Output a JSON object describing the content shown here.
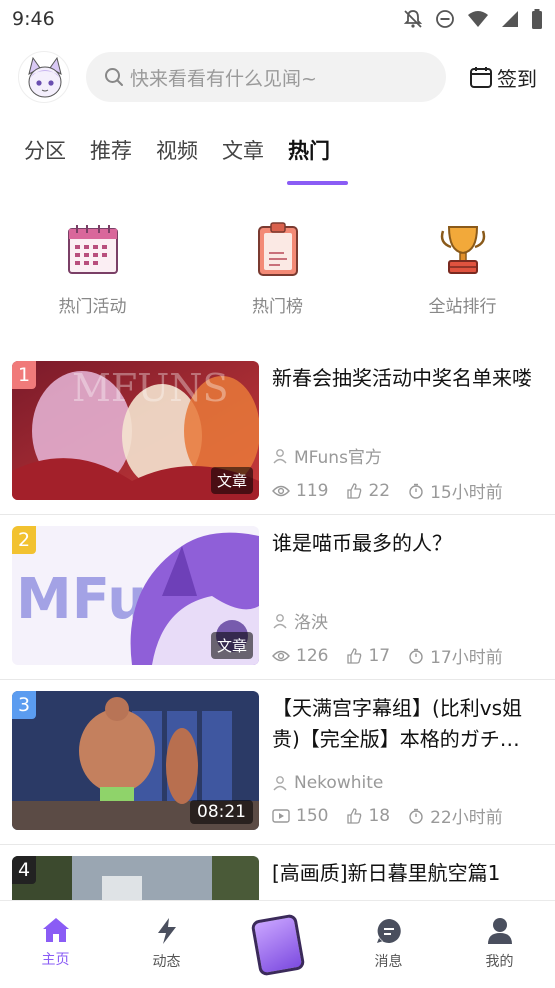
{
  "status_bar": {
    "time": "9:46"
  },
  "header": {
    "search_placeholder": "快来看看有什么见闻~",
    "checkin_label": "签到"
  },
  "tabs": [
    {
      "label": "分区"
    },
    {
      "label": "推荐"
    },
    {
      "label": "视频"
    },
    {
      "label": "文章"
    },
    {
      "label": "热门",
      "active": true
    }
  ],
  "quick_entries": [
    {
      "label": "热门活动",
      "icon": "calendar-icon"
    },
    {
      "label": "热门榜",
      "icon": "clipboard-icon"
    },
    {
      "label": "全站排行",
      "icon": "trophy-icon"
    }
  ],
  "feed": [
    {
      "rank": "1",
      "rank_color": "#f07a7a",
      "title": "新春会抽奖活动中奖名单来喽",
      "tag": "文章",
      "author": "MFuns官方",
      "views": "119",
      "likes": "22",
      "time": "15小时前"
    },
    {
      "rank": "2",
      "rank_color": "#f2c230",
      "title": "谁是喵币最多的人？",
      "tag": "文章",
      "author": "洛泱",
      "views": "126",
      "likes": "17",
      "time": "17小时前"
    },
    {
      "rank": "3",
      "rank_color": "#5b9cf0",
      "title": "【天满宫字幕组】(比利vs姐贵)【完全版】本格的ガチ…",
      "tag": "08:21",
      "author": "Nekowhite",
      "views": "150",
      "likes": "18",
      "time": "22小时前"
    },
    {
      "rank": "4",
      "rank_color": "#222222",
      "title": "[高画质]新日暮里航空篇1"
    }
  ],
  "bottom_nav": [
    {
      "label": "主页",
      "icon": "home-icon",
      "active": true
    },
    {
      "label": "动态",
      "icon": "lightning-icon"
    },
    {
      "label": "",
      "icon": "center-mascot-icon"
    },
    {
      "label": "消息",
      "icon": "chat-icon"
    },
    {
      "label": "我的",
      "icon": "user-icon"
    }
  ],
  "colors": {
    "accent": "#8a5cf5"
  }
}
